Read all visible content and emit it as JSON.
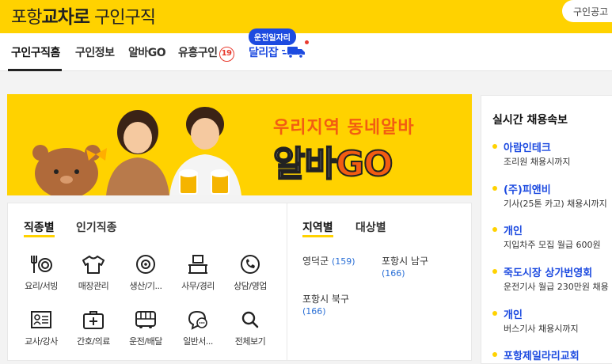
{
  "header": {
    "city": "포항",
    "brand": "교차로",
    "section": "구인구직",
    "search_button": "구인공고"
  },
  "nav": {
    "items": [
      {
        "label": "구인구직홈"
      },
      {
        "label": "구인정보"
      },
      {
        "label": "알바GO"
      },
      {
        "label": "유흥구인",
        "badge": "19"
      },
      {
        "label": "달리잡"
      }
    ],
    "tag": "운전일자리"
  },
  "banner": {
    "line1": "우리지역 동네알바",
    "line2_a": "알바",
    "line2_b": "GO"
  },
  "categories": {
    "tabs": [
      "직종별",
      "인기직종"
    ],
    "items": [
      {
        "label": "요리/서빙",
        "icon": "utensils-icon"
      },
      {
        "label": "매장관리",
        "icon": "shirt-icon"
      },
      {
        "label": "생산/기...",
        "icon": "gear-icon"
      },
      {
        "label": "사무/경리",
        "icon": "office-icon"
      },
      {
        "label": "상담/영업",
        "icon": "phone-icon"
      },
      {
        "label": "교사/강사",
        "icon": "board-icon"
      },
      {
        "label": "간호/의료",
        "icon": "medkit-icon"
      },
      {
        "label": "운전/배달",
        "icon": "bus-icon"
      },
      {
        "label": "일반서...",
        "icon": "chat-icon"
      },
      {
        "label": "전체보기",
        "icon": "search-icon"
      }
    ]
  },
  "regions": {
    "tabs": [
      "지역별",
      "대상별"
    ],
    "items": [
      {
        "name": "영덕군",
        "count": "(159)"
      },
      {
        "name": "포항시 남구",
        "count": "(166)"
      },
      {
        "name": "포항시 북구",
        "count": "(166)"
      }
    ]
  },
  "sidebar": {
    "title": "실시간 채용속보",
    "jobs": [
      {
        "name": "아람인테크",
        "desc": "조리원 채용시까지"
      },
      {
        "name": "(주)피앤비",
        "desc": "기사(25톤 카고) 채용시까지"
      },
      {
        "name": "개인",
        "desc": "지입차주 모집 월급 600원"
      },
      {
        "name": "죽도시장 상가번영회",
        "desc": "운전기사 월급 230만원 채용"
      },
      {
        "name": "개인",
        "desc": "버스기사 채용시까지"
      },
      {
        "name": "포항제일라리교회",
        "desc": ""
      }
    ]
  },
  "colors": {
    "brand_yellow": "#ffd200",
    "link_blue": "#1d4be0",
    "accent_orange": "#f25c12",
    "badge_red": "#e83a2e"
  }
}
